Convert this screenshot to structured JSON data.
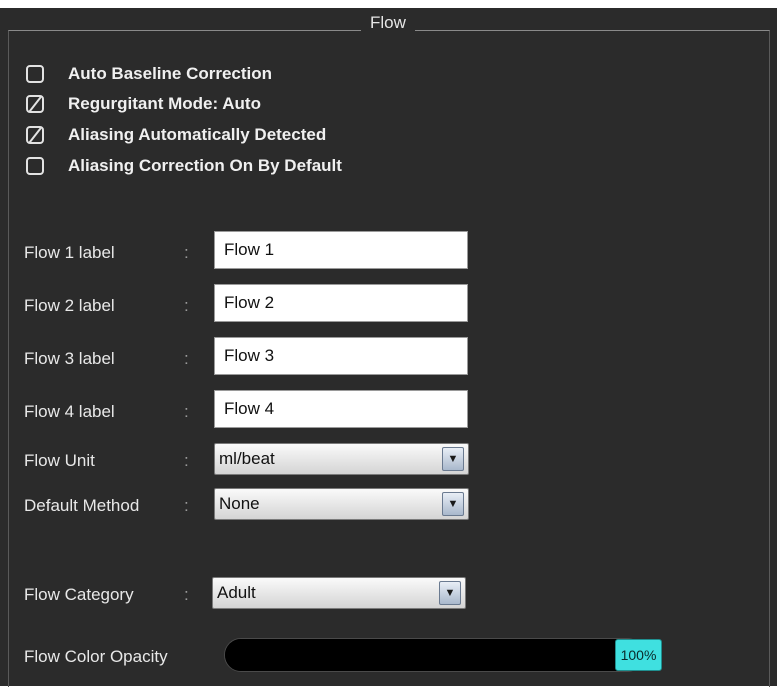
{
  "group": {
    "title": "Flow"
  },
  "checkboxes": [
    {
      "label": "Auto Baseline Correction",
      "checked": false
    },
    {
      "label": "Regurgitant Mode: Auto",
      "checked": true
    },
    {
      "label": "Aliasing Automatically Detected",
      "checked": true
    },
    {
      "label": "Aliasing Correction On By Default",
      "checked": false
    }
  ],
  "colon": ":",
  "fields": {
    "flow1": {
      "label": "Flow 1 label",
      "value": "Flow 1"
    },
    "flow2": {
      "label": "Flow 2 label",
      "value": "Flow 2"
    },
    "flow3": {
      "label": "Flow 3 label",
      "value": "Flow 3"
    },
    "flow4": {
      "label": "Flow 4 label",
      "value": "Flow 4"
    }
  },
  "flow_unit": {
    "label": "Flow Unit",
    "value": "ml/beat"
  },
  "default_method": {
    "label": "Default Method",
    "value": "None"
  },
  "flow_category": {
    "label": "Flow Category",
    "value": "Adult"
  },
  "opacity": {
    "label": "Flow Color Opacity",
    "value_text": "100%",
    "value": 1.0
  },
  "icons": {
    "dropdown": "dropdown-arrow-icon",
    "glyph": "▼"
  },
  "colors": {
    "panel_bg": "#2b2b2b",
    "handle_accent": "#3fe0e0"
  }
}
